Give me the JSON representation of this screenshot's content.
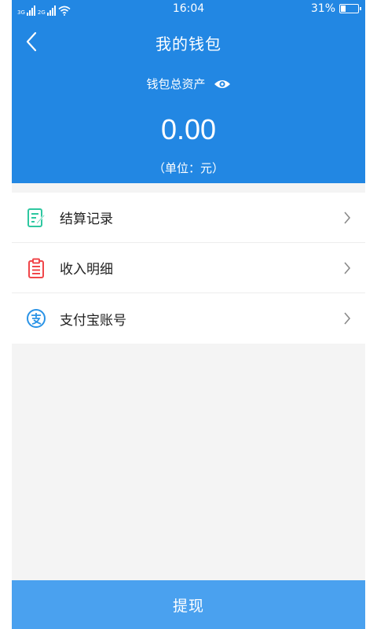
{
  "status_bar": {
    "sim1_label": "3G",
    "sim2_label": "2G",
    "time": "16:04",
    "battery_text": "31%",
    "battery_level": 0.31
  },
  "header": {
    "title": "我的钱包",
    "asset_label": "钱包总资产",
    "amount": "0.00",
    "unit": "（单位：元）"
  },
  "menu": {
    "items": [
      {
        "label": "结算记录",
        "icon": "edit-document-icon",
        "color": "#2ec7a0"
      },
      {
        "label": "收入明细",
        "icon": "clipboard-list-icon",
        "color": "#f0464a"
      },
      {
        "label": "支付宝账号",
        "icon": "alipay-icon",
        "color": "#2a93e6"
      }
    ]
  },
  "footer": {
    "withdraw_label": "提现"
  },
  "colors": {
    "header_bg": "#2287e3",
    "button_bg": "#4aa1ef",
    "page_bg": "#f4f4f4"
  }
}
